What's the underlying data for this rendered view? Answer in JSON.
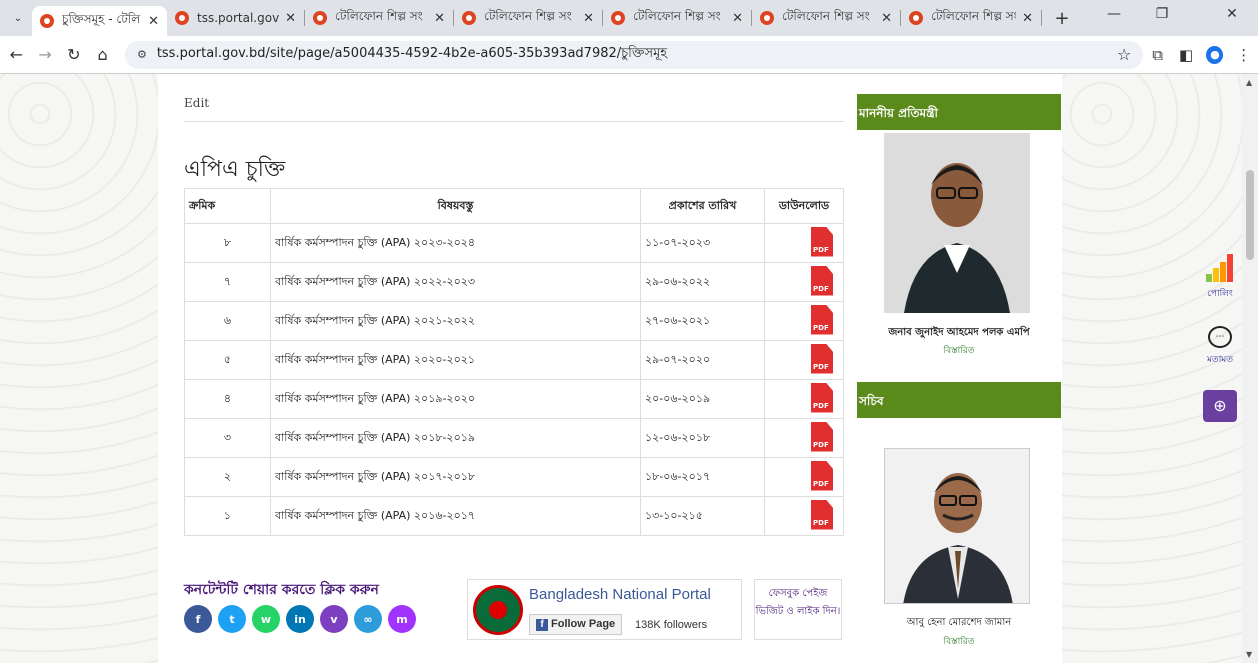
{
  "browser": {
    "tabs": [
      {
        "title": "চুক্তিসমূহ - টেলি",
        "active": true
      },
      {
        "title": "tss.portal.gov.bd",
        "active": false
      },
      {
        "title": "টেলিফোন শিল্প সং",
        "active": false
      },
      {
        "title": "টেলিফোন শিল্প সং",
        "active": false
      },
      {
        "title": "টেলিফোন শিল্প সং",
        "active": false
      },
      {
        "title": "টেলিফোন শিল্প সং",
        "active": false
      },
      {
        "title": "টেলিফোন শিল্প সং",
        "active": false
      }
    ],
    "url": "tss.portal.gov.bd/site/page/a5004435-4592-4b2e-a605-35b393ad7982/চুক্তিসমূহ"
  },
  "page": {
    "edit_label": "Edit",
    "title": "এপিএ চুক্তি",
    "table": {
      "headers": [
        "ক্রমিক",
        "বিষয়বস্তু",
        "প্রকাশের তারিখ",
        "ডাউনলোড"
      ],
      "rows": [
        {
          "num": "৮",
          "subject": "বার্ষিক কর্মসম্পাদন চুক্তি (APA)   ২০২৩-২০২৪",
          "date": "১১-০৭-২০২৩"
        },
        {
          "num": "৭",
          "subject": "বার্ষিক কর্মসম্পাদন চুক্তি (APA)   ২০২২-২০২৩",
          "date": "২৯-০৬-২০২২"
        },
        {
          "num": "৬",
          "subject": "বার্ষিক কর্মসম্পাদন চুক্তি (APA)   ২০২১-২০২২",
          "date": "২৭-০৬-২০২১"
        },
        {
          "num": "৫",
          "subject": "বার্ষিক কর্মসম্পাদন চুক্তি (APA)    ২০২০-২০২১",
          "date": "২৯-০৭-২০২০"
        },
        {
          "num": "৪",
          "subject": "বার্ষিক কর্মসম্পাদন চুক্তি (APA)   ২০১৯-২০২০",
          "date": "২০-০৬-২০১৯"
        },
        {
          "num": "৩",
          "subject": "বার্ষিক কর্মসম্পাদন চুক্তি (APA)    ২০১৮-২০১৯",
          "date": "১২-০৬-২০১৮"
        },
        {
          "num": "২",
          "subject": "বার্ষিক কর্মসম্পাদন চুক্তি (APA)   ২০১৭-২০১৮",
          "date": "১৮-০৬-২০১৭"
        },
        {
          "num": "১",
          "subject": "বার্ষিক কর্মসম্পাদন চুক্তি (APA)   ২০১৬-২০১৭",
          "date": "১৩-১০-২১৫"
        }
      ],
      "pdf_label": "PDF"
    },
    "share_text": "কনটেন্টটি শেয়ার করতে ক্লিক করুন",
    "fb": {
      "name": "Bangladesh National Portal",
      "follow": "Follow Page",
      "followers": "138K followers",
      "visit": "ফেসবুক পেইজ ভিজিট ও লাইক দিন।"
    }
  },
  "sidebar": {
    "minister_heading": "মাননীয় প্রতিমন্ত্রী",
    "minister_name": "জনাব জুনাইদ আহমেদ পলক এমপি",
    "minister_details": "বিস্তারিত",
    "secretary_heading": "সচিব",
    "secretary_name": "আবু হেনা মোরশেদ জামান",
    "secretary_details": "বিস্তারিত"
  },
  "floating": {
    "poll_label": "পোলিং",
    "feedback_label": "মতামত"
  },
  "colors": {
    "sidebar_header": "#5a8a1a",
    "share_text": "#4a1a7a",
    "pdf_red": "#e12e2e"
  }
}
